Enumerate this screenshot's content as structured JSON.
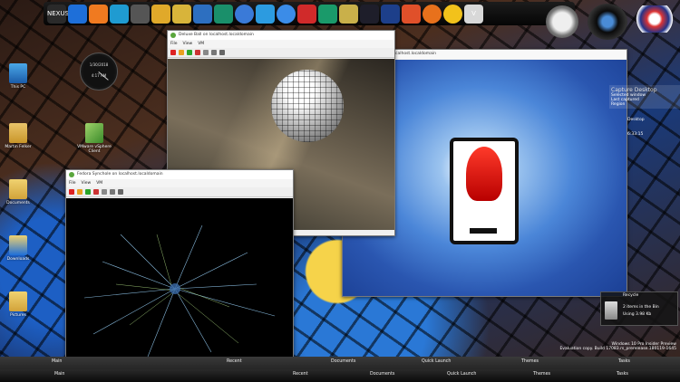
{
  "dock": {
    "icons": [
      {
        "name": "nexus-logo-icon",
        "color": "#2a2a2a",
        "label": "NEXUS"
      },
      {
        "name": "windows-flag-icon",
        "color": "#1e6fd9"
      },
      {
        "name": "search-icon",
        "color": "#f07a20"
      },
      {
        "name": "nexus-n-icon",
        "color": "#1f9bd1"
      },
      {
        "name": "gear-icon",
        "color": "#555555"
      },
      {
        "name": "folder-icon",
        "color": "#e0a92a"
      },
      {
        "name": "gamepad-icon",
        "color": "#d8b43a"
      },
      {
        "name": "download-icon",
        "color": "#2d6fc0"
      },
      {
        "name": "u-app-icon",
        "color": "#1a8f6a"
      },
      {
        "name": "settings-wheel-icon",
        "color": "#3a7ad8"
      },
      {
        "name": "triangle-app-icon",
        "color": "#2c9be0"
      },
      {
        "name": "globe-icon",
        "color": "#3b8ce8"
      },
      {
        "name": "grid-app-icon",
        "color": "#d02a2a"
      },
      {
        "name": "u-app-2-icon",
        "color": "#1a9a6a"
      },
      {
        "name": "photo-viewer-icon",
        "color": "#c9b04a"
      },
      {
        "name": "terminal-icon",
        "color": "#1e1e2a"
      },
      {
        "name": "powershell-icon",
        "color": "#1d3f8a"
      },
      {
        "name": "spiral-icon",
        "color": "#e0502a"
      },
      {
        "name": "firefox-icon",
        "color": "#e8711c"
      },
      {
        "name": "chrome-icon",
        "color": "#f2c21b"
      },
      {
        "name": "vivaldi-icon",
        "color": "#d8d8d8",
        "label": "V"
      }
    ]
  },
  "desktop_icons": [
    {
      "name": "this-pc-icon",
      "label": "This PC"
    },
    {
      "name": "user-folder-icon",
      "label": "Martin Felker"
    },
    {
      "name": "documents-icon",
      "label": "Documents"
    },
    {
      "name": "downloads-icon",
      "label": "Downloads"
    },
    {
      "name": "pictures-icon",
      "label": "Pictures"
    },
    {
      "name": "vmware-icon",
      "label": "VMware vSphere Client"
    }
  ],
  "clock": {
    "date": "1/30/2018",
    "time": "4:17 AM"
  },
  "windows": {
    "glass": {
      "title": "Deluxe Ball on localhost.localdomain",
      "menu": [
        "File",
        "View",
        "VM"
      ]
    },
    "fedora": {
      "title": "Fedora Synchole on localhost.localdomain",
      "menu": [
        "File",
        "View",
        "VM"
      ]
    },
    "right": {
      "title": "localhost.localdomain"
    }
  },
  "widgets": {
    "capture": {
      "title": "Capture Desktop",
      "line1": "Selected window",
      "line2": "Last captured",
      "line3": "Region"
    },
    "desktop_label": "Desktop",
    "time": "6:33:15",
    "recycle": {
      "title": "Recycle",
      "line1": "2 items in the Bin",
      "line2": "Using 3.98 Kb"
    },
    "watermark": {
      "line1": "Windows 10 Pro Insider Preview",
      "line2": "Evaluation copy. Build 17083.rs_prerelease.180119-1645"
    }
  },
  "taskbar": {
    "top_tabs": [
      "Main",
      "Recent",
      "Documents",
      "Quick Launch",
      "Themes",
      "Tasks"
    ],
    "bottom_tabs": [
      "Main",
      "Recent",
      "Documents",
      "Quick Launch",
      "Themes",
      "Tasks"
    ]
  }
}
